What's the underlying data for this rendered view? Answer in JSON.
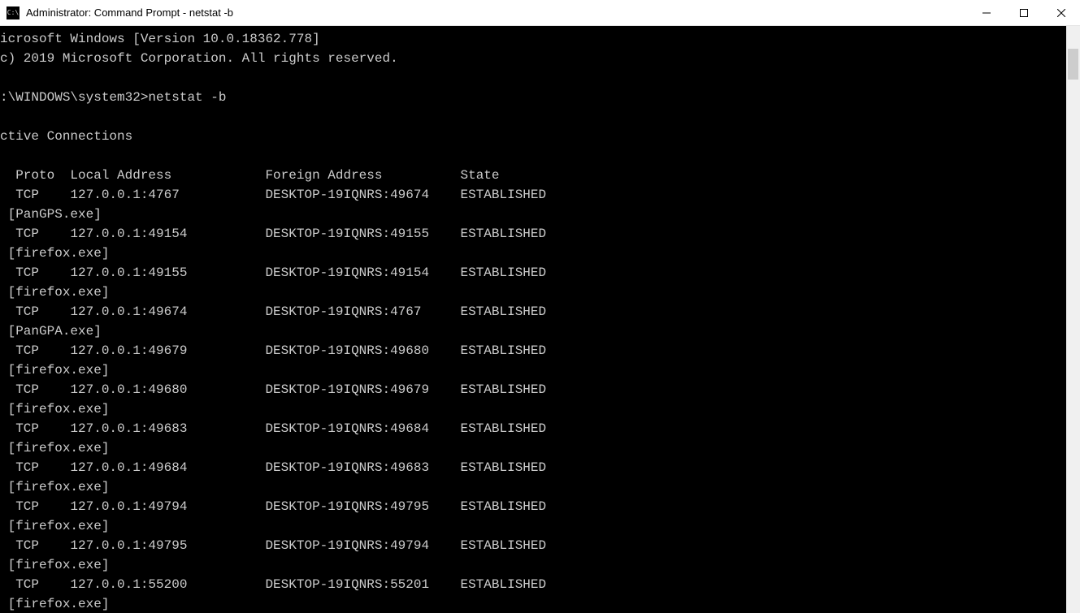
{
  "window": {
    "title": "Administrator: Command Prompt - netstat  -b",
    "icon_label": "C:\\"
  },
  "console": {
    "banner1": "icrosoft Windows [Version 10.0.18362.778]",
    "banner2": "c) 2019 Microsoft Corporation. All rights reserved.",
    "prompt_path": ":\\WINDOWS\\system32>",
    "command": "netstat -b",
    "header_title": "ctive Connections",
    "columns": {
      "proto": "Proto",
      "local": "Local Address",
      "foreign": "Foreign Address",
      "state": "State"
    },
    "rows": [
      {
        "proto": "TCP",
        "local": "127.0.0.1:4767",
        "foreign": "DESKTOP-19IQNRS:49674",
        "state": "ESTABLISHED",
        "owner": "[PanGPS.exe]"
      },
      {
        "proto": "TCP",
        "local": "127.0.0.1:49154",
        "foreign": "DESKTOP-19IQNRS:49155",
        "state": "ESTABLISHED",
        "owner": "[firefox.exe]"
      },
      {
        "proto": "TCP",
        "local": "127.0.0.1:49155",
        "foreign": "DESKTOP-19IQNRS:49154",
        "state": "ESTABLISHED",
        "owner": "[firefox.exe]"
      },
      {
        "proto": "TCP",
        "local": "127.0.0.1:49674",
        "foreign": "DESKTOP-19IQNRS:4767",
        "state": "ESTABLISHED",
        "owner": "[PanGPA.exe]"
      },
      {
        "proto": "TCP",
        "local": "127.0.0.1:49679",
        "foreign": "DESKTOP-19IQNRS:49680",
        "state": "ESTABLISHED",
        "owner": "[firefox.exe]"
      },
      {
        "proto": "TCP",
        "local": "127.0.0.1:49680",
        "foreign": "DESKTOP-19IQNRS:49679",
        "state": "ESTABLISHED",
        "owner": "[firefox.exe]"
      },
      {
        "proto": "TCP",
        "local": "127.0.0.1:49683",
        "foreign": "DESKTOP-19IQNRS:49684",
        "state": "ESTABLISHED",
        "owner": "[firefox.exe]"
      },
      {
        "proto": "TCP",
        "local": "127.0.0.1:49684",
        "foreign": "DESKTOP-19IQNRS:49683",
        "state": "ESTABLISHED",
        "owner": "[firefox.exe]"
      },
      {
        "proto": "TCP",
        "local": "127.0.0.1:49794",
        "foreign": "DESKTOP-19IQNRS:49795",
        "state": "ESTABLISHED",
        "owner": "[firefox.exe]"
      },
      {
        "proto": "TCP",
        "local": "127.0.0.1:49795",
        "foreign": "DESKTOP-19IQNRS:49794",
        "state": "ESTABLISHED",
        "owner": "[firefox.exe]"
      },
      {
        "proto": "TCP",
        "local": "127.0.0.1:55200",
        "foreign": "DESKTOP-19IQNRS:55201",
        "state": "ESTABLISHED",
        "owner": "[firefox.exe]"
      }
    ]
  }
}
